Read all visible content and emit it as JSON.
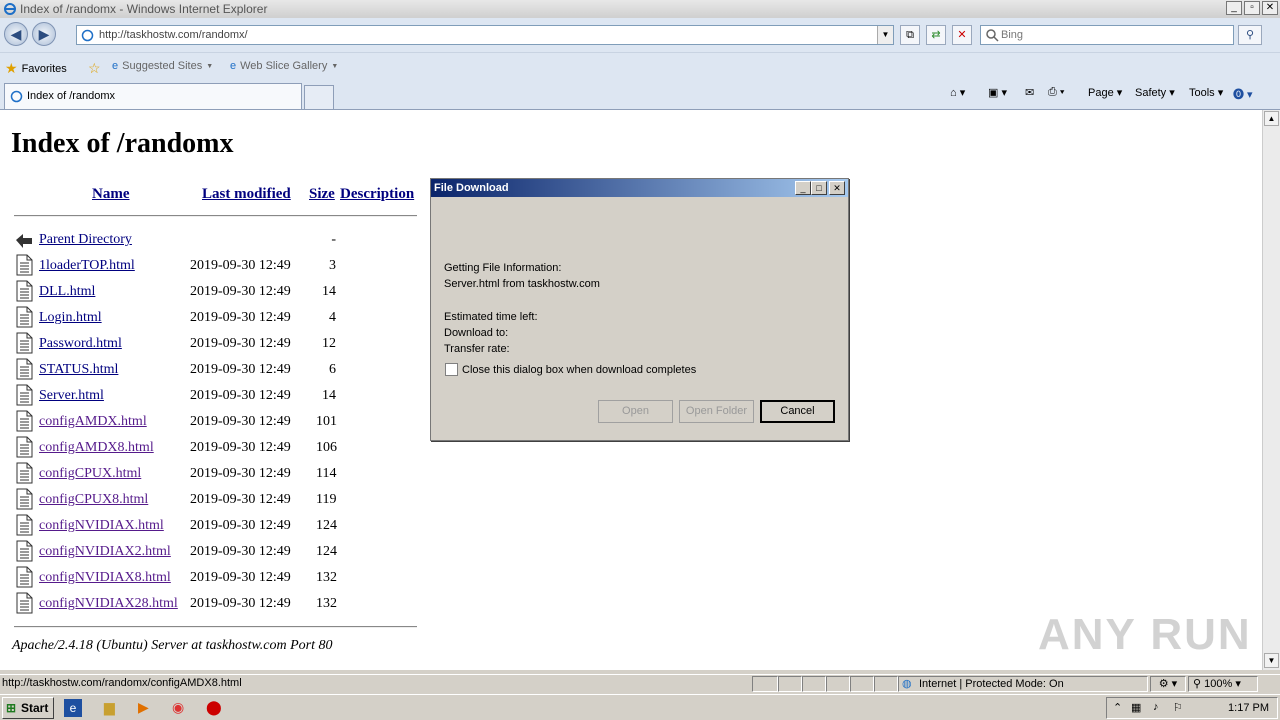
{
  "window": {
    "title": "Index of /randomx - Windows Internet Explorer",
    "min": "_",
    "max": "▫",
    "close": "✕"
  },
  "address": {
    "url": "http://taskhostw.com/randomx/",
    "search_placeholder": "Bing"
  },
  "favorites": {
    "favorites_label": "Favorites",
    "suggested_label": "Suggested Sites",
    "webslice_label": "Web Slice Gallery"
  },
  "tab": {
    "label": "Index of /randomx"
  },
  "commands": {
    "page": "Page",
    "safety": "Safety",
    "tools": "Tools"
  },
  "listing": {
    "heading": "Index of /randomx",
    "columns": {
      "name": "Name",
      "modified": "Last modified",
      "size": "Size",
      "description": "Description"
    },
    "parent": {
      "name": "Parent Directory",
      "size": "-"
    },
    "files": [
      {
        "name": "1loaderTOP.html",
        "date": "2019-09-30 12:49",
        "size": "3",
        "visited": false
      },
      {
        "name": "DLL.html",
        "date": "2019-09-30 12:49",
        "size": "14",
        "visited": false
      },
      {
        "name": "Login.html",
        "date": "2019-09-30 12:49",
        "size": "4",
        "visited": false
      },
      {
        "name": "Password.html",
        "date": "2019-09-30 12:49",
        "size": "12",
        "visited": false
      },
      {
        "name": "STATUS.html",
        "date": "2019-09-30 12:49",
        "size": "6",
        "visited": false
      },
      {
        "name": "Server.html",
        "date": "2019-09-30 12:49",
        "size": "14",
        "visited": false
      },
      {
        "name": "configAMDX.html",
        "date": "2019-09-30 12:49",
        "size": "101",
        "visited": true
      },
      {
        "name": "configAMDX8.html",
        "date": "2019-09-30 12:49",
        "size": "106",
        "visited": true
      },
      {
        "name": "configCPUX.html",
        "date": "2019-09-30 12:49",
        "size": "114",
        "visited": true
      },
      {
        "name": "configCPUX8.html",
        "date": "2019-09-30 12:49",
        "size": "119",
        "visited": true
      },
      {
        "name": "configNVIDIAX.html",
        "date": "2019-09-30 12:49",
        "size": "124",
        "visited": true
      },
      {
        "name": "configNVIDIAX2.html",
        "date": "2019-09-30 12:49",
        "size": "124",
        "visited": true
      },
      {
        "name": "configNVIDIAX8.html",
        "date": "2019-09-30 12:49",
        "size": "132",
        "visited": true
      },
      {
        "name": "configNVIDIAX28.html",
        "date": "2019-09-30 12:49",
        "size": "132",
        "visited": true
      }
    ],
    "server_signature": "Apache/2.4.18 (Ubuntu) Server at taskhostw.com Port 80"
  },
  "watermark": "ANY RUN",
  "dialog": {
    "title": "File Download",
    "getting_info": "Getting File Information:",
    "file_line": "Server.html from taskhostw.com",
    "est_time": "Estimated time left:",
    "download_to": "Download to:",
    "transfer_rate": "Transfer rate:",
    "close_checkbox": "Close this dialog box when download completes",
    "open": "Open",
    "open_folder": "Open Folder",
    "cancel": "Cancel"
  },
  "status": {
    "url": "http://taskhostw.com/randomx/configAMDX8.html",
    "zone": "Internet | Protected Mode: On",
    "zoom": "100%"
  },
  "taskbar": {
    "start": "Start",
    "clock": "1:17 PM"
  }
}
